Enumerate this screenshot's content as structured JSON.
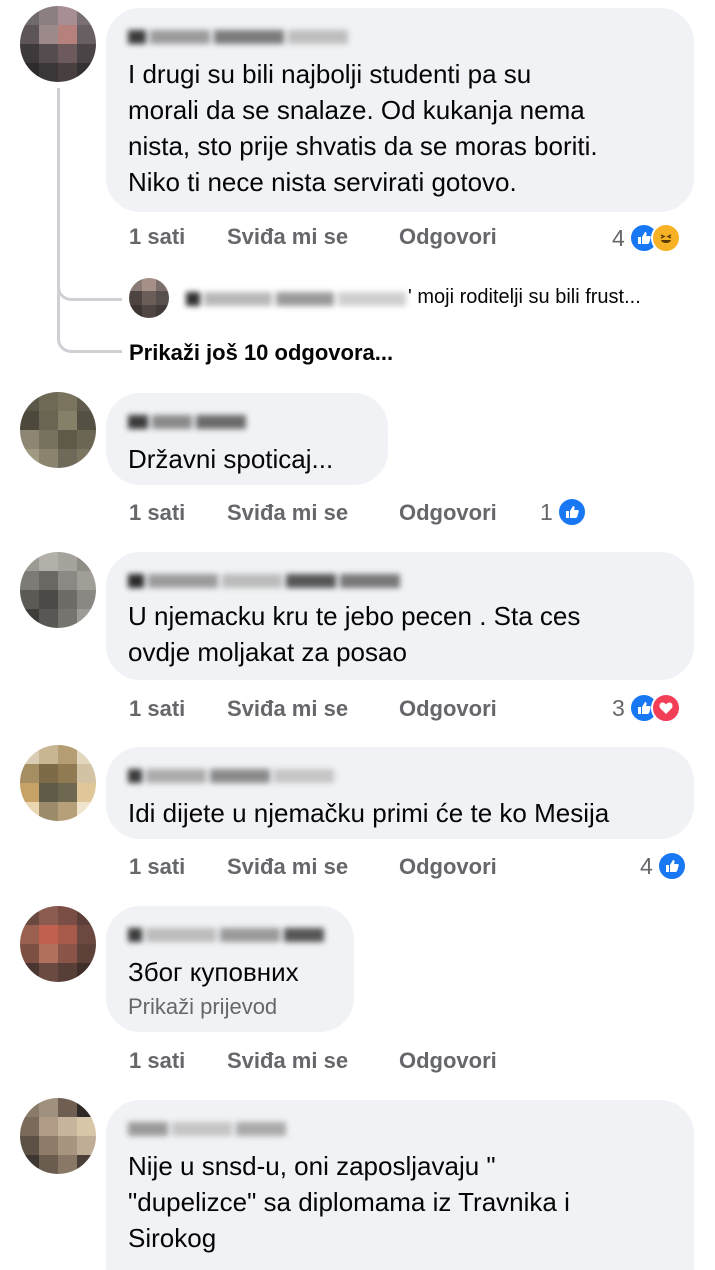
{
  "actions": {
    "time": "1 sati",
    "like": "Sviđa mi se",
    "reply": "Odgovori"
  },
  "comments": [
    {
      "text": "I drugi su bili najbolji studenti pa su\nmorali da se snalaze. Od kukanja nema\nnista, sto prije shvatis da se moras boriti.\nNiko ti nece nista servirati gotovo.",
      "reaction_count": "4",
      "reactions": [
        "like-icon",
        "haha-icon"
      ]
    },
    {
      "text": "Državni spoticaj...",
      "reaction_count": "1",
      "reactions": [
        "like-icon"
      ]
    },
    {
      "text": "U njemacku kru te jebo pecen . Sta ces\novdje moljakat za posao",
      "reaction_count": "3",
      "reactions": [
        "like-icon",
        "heart-icon"
      ]
    },
    {
      "text": "Idi dijete u njemačku primi će te ko Mesija",
      "reaction_count": "4",
      "reactions": [
        "like-icon"
      ]
    },
    {
      "text": "Због куповних",
      "translate_label": "Prikaži prijevod",
      "reaction_count": "",
      "reactions": []
    },
    {
      "text": "Nije u snsd-u, oni zaposljavaju \"\n\"dupelizce\" sa diplomama iz Travnika i\nSirokog",
      "reaction_count": "",
      "reactions": []
    }
  ],
  "reply_preview": {
    "text": "' moji roditelji su bili frust..."
  },
  "more_replies": "Prikaži još 10 odgovora...",
  "colors": {
    "bubble": "#f0f2f5",
    "meta_text": "#65676b",
    "like_blue": "#1877f2",
    "heart_red": "#f33e58",
    "haha_yellow": "#f7b125"
  }
}
